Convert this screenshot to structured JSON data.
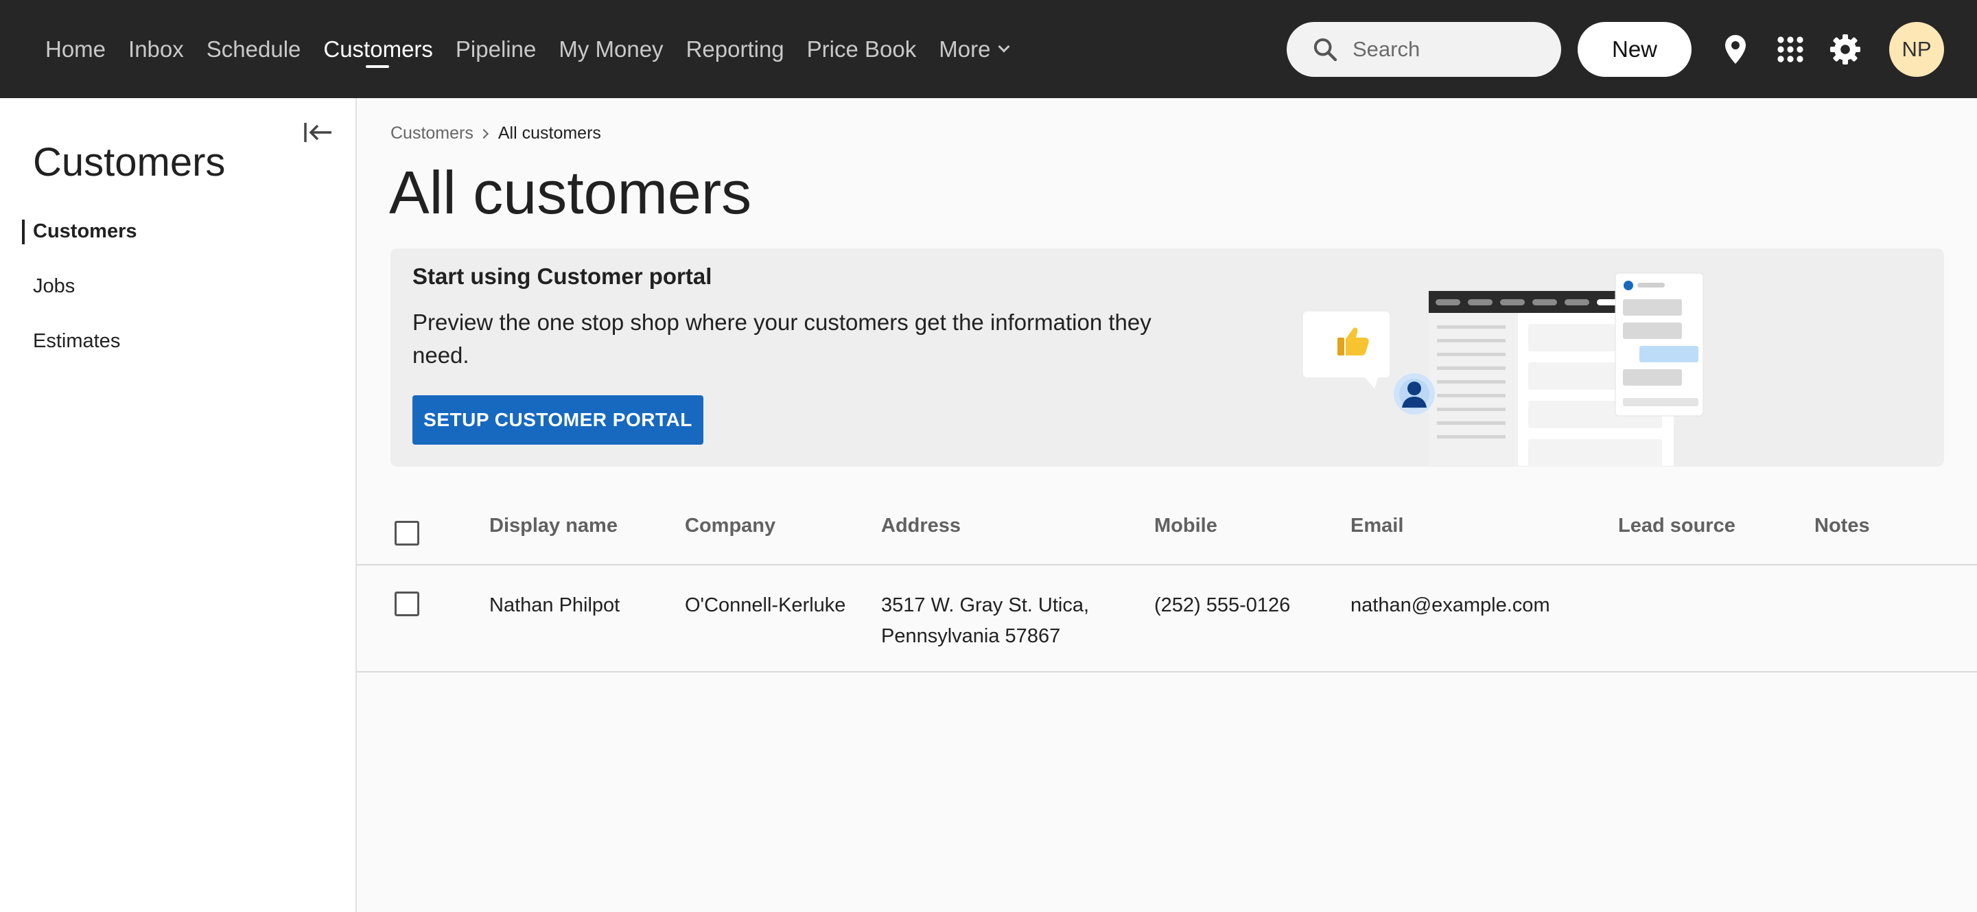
{
  "nav": {
    "items": [
      "Home",
      "Inbox",
      "Schedule",
      "Customers",
      "Pipeline",
      "My Money",
      "Reporting",
      "Price Book",
      "More"
    ],
    "active": "Customers",
    "search_placeholder": "Search",
    "new_label": "New",
    "avatar_initials": "NP"
  },
  "sidebar": {
    "title": "Customers",
    "items": [
      "Customers",
      "Jobs",
      "Estimates"
    ],
    "active": "Customers"
  },
  "breadcrumb": {
    "parent": "Customers",
    "current": "All customers"
  },
  "page_title": "All customers",
  "banner": {
    "title": "Start using Customer portal",
    "text": "Preview the one stop shop where your customers get the information they need.",
    "button_label": "SETUP CUSTOMER PORTAL"
  },
  "table": {
    "columns": [
      "Display name",
      "Company",
      "Address",
      "Mobile",
      "Email",
      "Lead source",
      "Notes"
    ],
    "rows": [
      {
        "display_name": "Nathan Philpot",
        "company": "O'Connell-Kerluke",
        "address_line1": "3517 W. Gray St. Utica,",
        "address_line2": "Pennsylvania 57867",
        "mobile": "(252) 555-0126",
        "email": "nathan@example.com",
        "lead_source": "",
        "notes": ""
      }
    ]
  },
  "colors": {
    "topbar": "#262626",
    "primary_button": "#1769c0",
    "avatar_bg": "#fde7b5"
  },
  "icons": [
    "search-icon",
    "chevron-down-icon",
    "location-pin-icon",
    "apps-grid-icon",
    "gear-icon",
    "collapse-sidebar-icon",
    "chevron-right-icon",
    "thumbs-up-icon",
    "user-icon"
  ]
}
